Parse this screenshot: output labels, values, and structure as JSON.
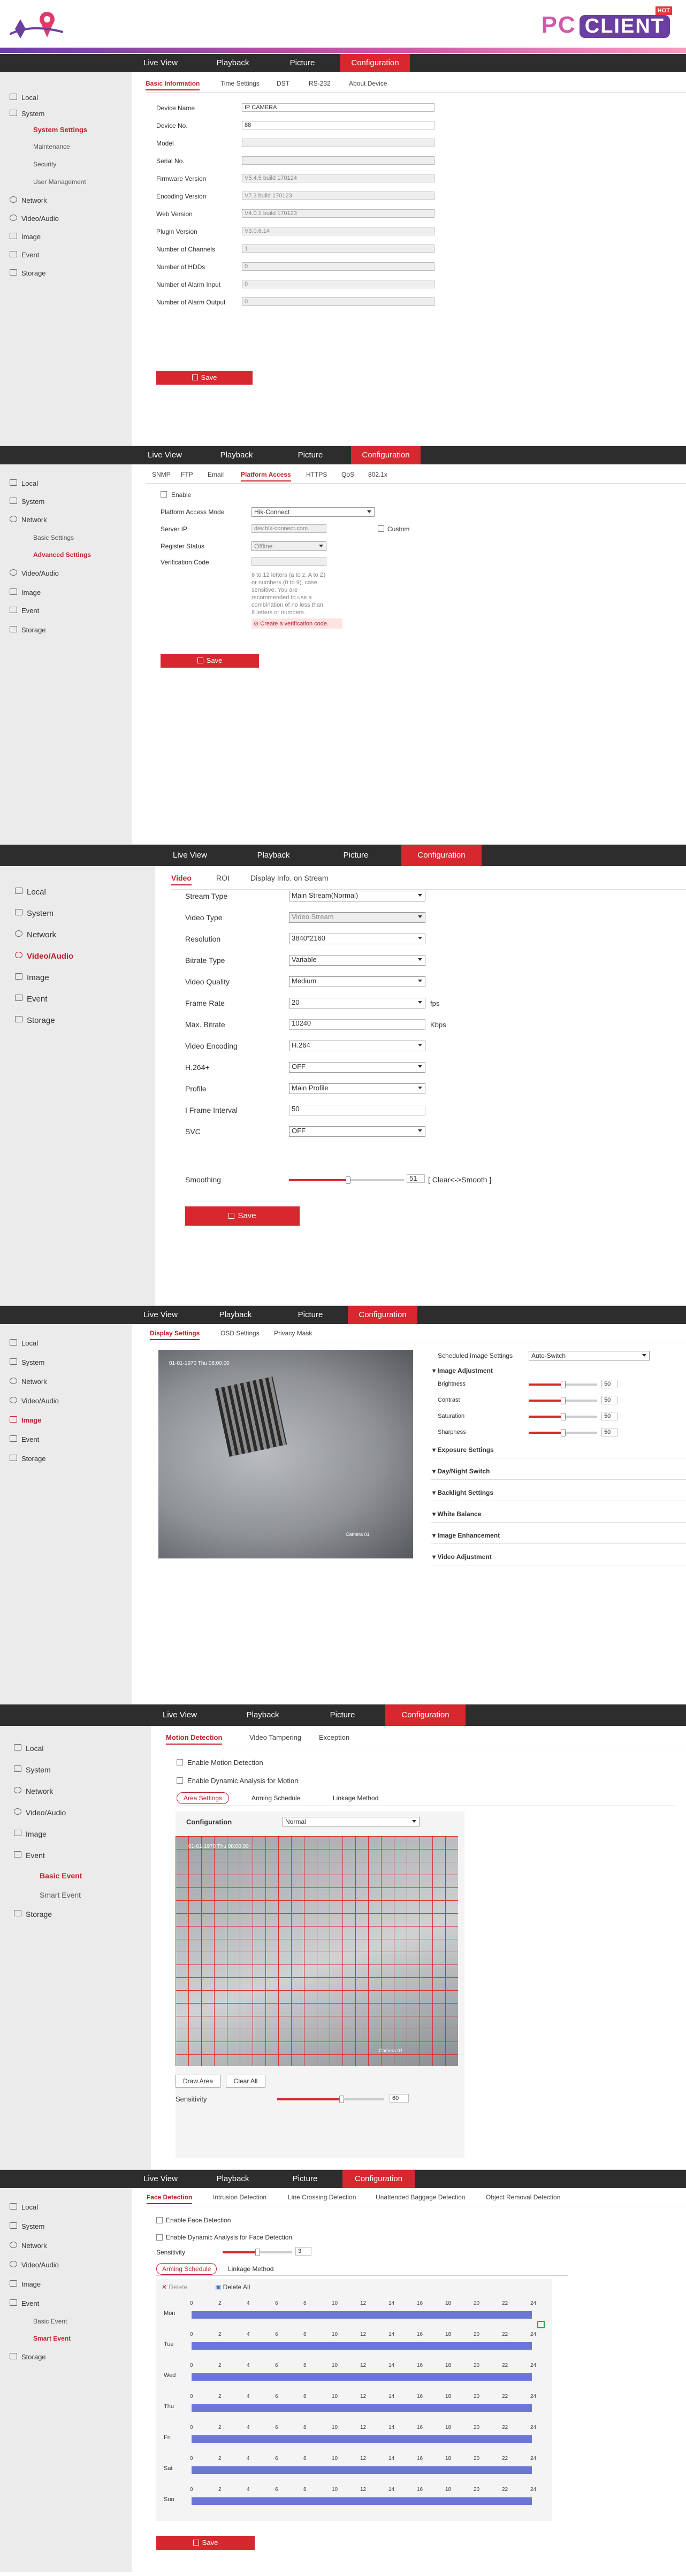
{
  "banner": {
    "brand_text": "PC",
    "brand_pill": "CLIENT",
    "hot": "HOT"
  },
  "topnav": [
    "Live View",
    "Playback",
    "Picture",
    "Configuration"
  ],
  "s1": {
    "side": {
      "local": "Local",
      "system": "System",
      "system_settings": "System Settings",
      "maintenance": "Maintenance",
      "security": "Security",
      "user_mgmt": "User Management",
      "network": "Network",
      "video_audio": "Video/Audio",
      "image": "Image",
      "event": "Event",
      "storage": "Storage"
    },
    "tabs": [
      "Basic Information",
      "Time Settings",
      "DST",
      "RS-232",
      "About Device"
    ],
    "fields": [
      {
        "label": "Device Name",
        "value": "IP CAMERA",
        "ro": false
      },
      {
        "label": "Device No.",
        "value": "88",
        "ro": false
      },
      {
        "label": "Model",
        "value": "",
        "ro": true
      },
      {
        "label": "Serial No.",
        "value": "",
        "ro": true
      },
      {
        "label": "Firmware Version",
        "value": "V5.4.5 build 170124",
        "ro": true
      },
      {
        "label": "Encoding Version",
        "value": "V7.3 build 170123",
        "ro": true
      },
      {
        "label": "Web Version",
        "value": "V4.0.1 build 170123",
        "ro": true
      },
      {
        "label": "Plugin Version",
        "value": "V3.0.6.14",
        "ro": true
      },
      {
        "label": "Number of Channels",
        "value": "1",
        "ro": true
      },
      {
        "label": "Number of HDDs",
        "value": "0",
        "ro": true
      },
      {
        "label": "Number of Alarm Input",
        "value": "0",
        "ro": true
      },
      {
        "label": "Number of Alarm Output",
        "value": "0",
        "ro": true
      }
    ],
    "save": "Save"
  },
  "s2": {
    "side": {
      "local": "Local",
      "system": "System",
      "network": "Network",
      "basic": "Basic Settings",
      "advanced": "Advanced Settings",
      "video_audio": "Video/Audio",
      "image": "Image",
      "event": "Event",
      "storage": "Storage"
    },
    "tabs": [
      "SNMP",
      "FTP",
      "Email",
      "Platform Access",
      "HTTPS",
      "QoS",
      "802.1x"
    ],
    "enable": "Enable",
    "mode_label": "Platform Access Mode",
    "mode_value": "Hik-Connect",
    "server_label": "Server IP",
    "server_value": "dev.hik-connect.com",
    "custom": "Custom",
    "status_label": "Register Status",
    "status_value": "Offline",
    "code_label": "Verification Code",
    "hint": "6 to 12 letters (a to z, A to Z) or numbers (0 to 9), case sensitive. You are recommended to use a combination of no less than 8 letters or numbers.",
    "create": "Create a verification code.",
    "save": "Save"
  },
  "s3": {
    "side": {
      "local": "Local",
      "system": "System",
      "network": "Network",
      "video_audio": "Video/Audio",
      "image": "Image",
      "event": "Event",
      "storage": "Storage"
    },
    "tabs": [
      "Video",
      "ROI",
      "Display Info. on Stream"
    ],
    "rows": [
      {
        "label": "Stream Type",
        "value": "Main Stream(Normal)",
        "kind": "sel"
      },
      {
        "label": "Video Type",
        "value": "Video Stream",
        "kind": "ro"
      },
      {
        "label": "Resolution",
        "value": "3840*2160",
        "kind": "sel"
      },
      {
        "label": "Bitrate Type",
        "value": "Variable",
        "kind": "sel"
      },
      {
        "label": "Video Quality",
        "value": "Medium",
        "kind": "sel"
      },
      {
        "label": "Frame Rate",
        "value": "20",
        "kind": "sel",
        "unit": "fps"
      },
      {
        "label": "Max. Bitrate",
        "value": "10240",
        "kind": "txt",
        "unit": "Kbps"
      },
      {
        "label": "Video Encoding",
        "value": "H.264",
        "kind": "sel"
      },
      {
        "label": "H.264+",
        "value": "OFF",
        "kind": "sel"
      },
      {
        "label": "Profile",
        "value": "Main Profile",
        "kind": "sel"
      },
      {
        "label": "I Frame Interval",
        "value": "50",
        "kind": "txt"
      },
      {
        "label": "SVC",
        "value": "OFF",
        "kind": "sel"
      }
    ],
    "smoothing_label": "Smoothing",
    "smoothing_value": "51",
    "smoothing_level": 0.51,
    "smoothing_hint": "[ Clear<->Smooth ]",
    "save": "Save"
  },
  "s4": {
    "side": {
      "local": "Local",
      "system": "System",
      "network": "Network",
      "video_audio": "Video/Audio",
      "image": "Image",
      "event": "Event",
      "storage": "Storage"
    },
    "tabs": [
      "Display Settings",
      "OSD Settings",
      "Privacy Mask"
    ],
    "osd_time": "01-01-1970 Thu 08:00:00",
    "osd_cam": "Camera 01",
    "sched_label": "Scheduled Image Settings",
    "sched_value": "Auto-Switch",
    "adj_header": "Image Adjustment",
    "adjust": [
      {
        "label": "Brightness",
        "value": "50",
        "level": 0.5
      },
      {
        "label": "Contrast",
        "value": "50",
        "level": 0.5
      },
      {
        "label": "Saturation",
        "value": "50",
        "level": 0.5
      },
      {
        "label": "Sharpness",
        "value": "50",
        "level": 0.5
      }
    ],
    "groups": [
      "Exposure Settings",
      "Day/Night Switch",
      "Backlight Settings",
      "White Balance",
      "Image Enhancement",
      "Video Adjustment"
    ]
  },
  "s5": {
    "side": {
      "local": "Local",
      "system": "System",
      "network": "Network",
      "video_audio": "Video/Audio",
      "image": "Image",
      "event": "Event",
      "basic": "Basic Event",
      "smart": "Smart Event",
      "storage": "Storage"
    },
    "tabs": [
      "Motion Detection",
      "Video Tampering",
      "Exception"
    ],
    "enable_md": "Enable Motion Detection",
    "enable_dyn": "Enable Dynamic Analysis for Motion",
    "subtabs": [
      "Area Settings",
      "Arming Schedule",
      "Linkage Method"
    ],
    "config_label": "Configuration",
    "config_value": "Normal",
    "osd_time": "01-01-1970 Thu 08:00:00",
    "osd_cam": "Camera 01",
    "draw": "Draw Area",
    "clear": "Clear All",
    "sens_label": "Sensitivity",
    "sens_value": "60",
    "sens_level": 0.6
  },
  "s6": {
    "side": {
      "local": "Local",
      "system": "System",
      "network": "Network",
      "video_audio": "Video/Audio",
      "image": "Image",
      "event": "Event",
      "basic": "Basic Event",
      "smart": "Smart Event",
      "storage": "Storage"
    },
    "tabs": [
      "Face Detection",
      "Intrusion Detection",
      "Line Crossing Detection",
      "Unattended Baggage Detection",
      "Object Removal Detection"
    ],
    "enable_fd": "Enable Face Detection",
    "enable_dyn": "Enable Dynamic Analysis for Face Detection",
    "sens_label": "Sensitivity",
    "sens_value": "3",
    "sens_level": 0.5,
    "subtabs": [
      "Arming Schedule",
      "Linkage Method"
    ],
    "delete": "Delete",
    "delete_all": "Delete All",
    "hours": [
      "0",
      "2",
      "4",
      "6",
      "8",
      "10",
      "12",
      "14",
      "16",
      "18",
      "20",
      "22",
      "24"
    ],
    "days": [
      "Mon",
      "Tue",
      "Wed",
      "Thu",
      "Fri",
      "Sat",
      "Sun"
    ],
    "save": "Save"
  },
  "colors": {
    "accent": "#d7282f",
    "topbar": "#2d2d2d",
    "sidebar": "#ebebeb",
    "schedule": "#6b76d7"
  }
}
